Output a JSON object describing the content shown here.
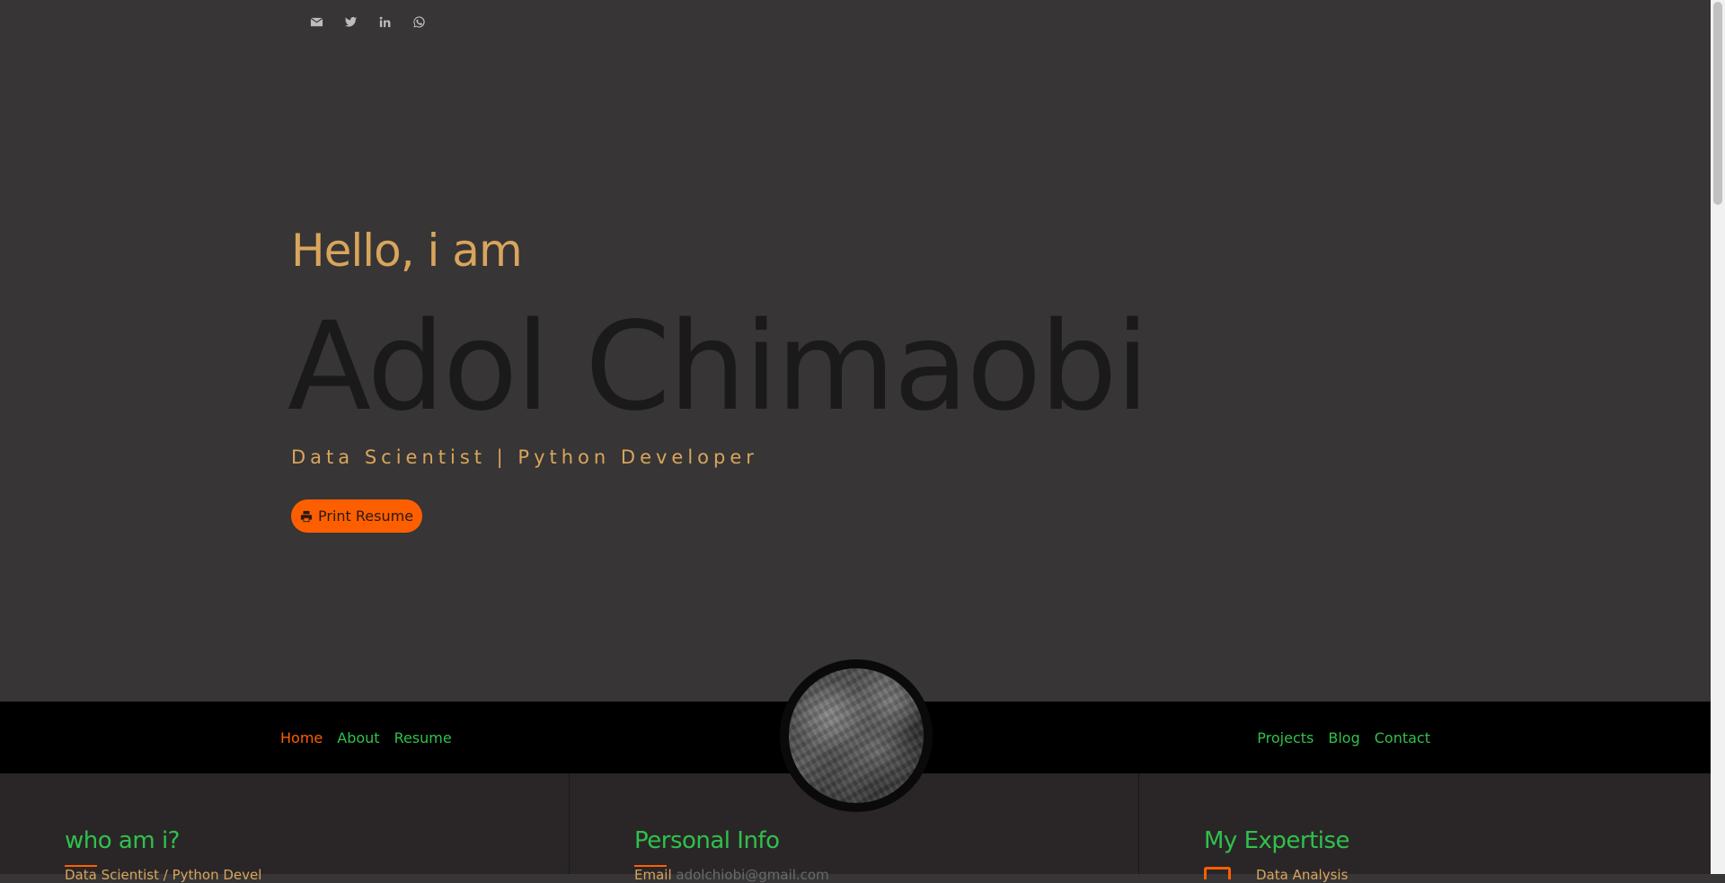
{
  "social": {
    "items": [
      {
        "icon": "envelope-icon",
        "label": "email"
      },
      {
        "icon": "twitter-icon",
        "label": "twitter"
      },
      {
        "icon": "linkedin-icon",
        "label": "linkedin"
      },
      {
        "icon": "whatsapp-icon",
        "label": "whatsapp"
      }
    ]
  },
  "hero": {
    "greeting": "Hello, i am",
    "name": "Adol Chimaobi",
    "subtitle": "Data Scientist | Python Developer",
    "print_button": "Print Resume"
  },
  "nav": {
    "left": [
      {
        "label": "Home",
        "active": true
      },
      {
        "label": "About",
        "active": false
      },
      {
        "label": "Resume",
        "active": false
      }
    ],
    "right": [
      {
        "label": "Projects",
        "active": false
      },
      {
        "label": "Blog",
        "active": false
      },
      {
        "label": "Contact",
        "active": false
      }
    ]
  },
  "sections": {
    "about": {
      "title": "who am i?",
      "partial_text": "Data Scientist / Python Devel"
    },
    "personal": {
      "title": "Personal Info",
      "partial_label": "Email",
      "partial_value": "adolchiobi@gmail.com"
    },
    "expertise": {
      "title": "My Expertise",
      "partial_item": "Data Analysis"
    }
  },
  "colors": {
    "background": "#373535",
    "accent": "#fd5f00",
    "gold": "#d9a55c",
    "green": "#2fc14c"
  }
}
